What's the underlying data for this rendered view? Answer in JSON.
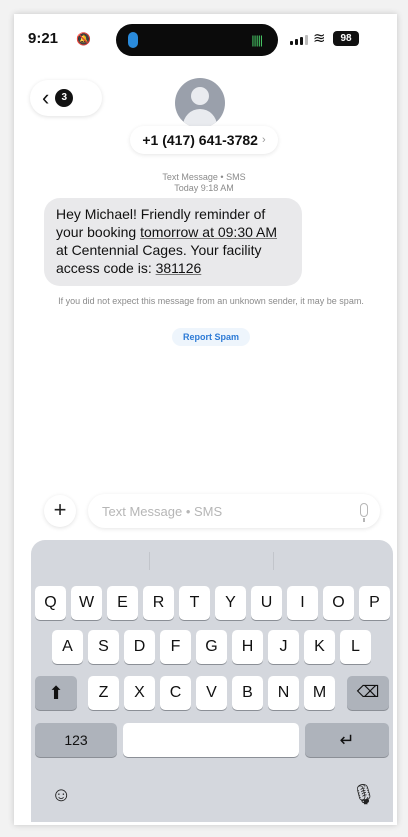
{
  "status": {
    "time": "9:21",
    "battery": "98"
  },
  "header": {
    "back_count": "3",
    "contact": "+1 (417) 641-3782"
  },
  "conversation": {
    "meta_line1": "Text Message • SMS",
    "meta_line2": "Today 9:18 AM",
    "message": {
      "part1": "Hey Michael! Friendly reminder of your booking ",
      "link_time": "tomorrow at 09:30 AM",
      "part2": " at Centennial Cages. Your facility access code is: ",
      "link_code": "381126"
    },
    "spam_note": "If you did not expect this message from an unknown sender, it may be spam.",
    "report_spam": "Report Spam"
  },
  "compose": {
    "placeholder": "Text Message • SMS"
  },
  "keyboard": {
    "row1": [
      "Q",
      "W",
      "E",
      "R",
      "T",
      "Y",
      "U",
      "I",
      "O",
      "P"
    ],
    "row2": [
      "A",
      "S",
      "D",
      "F",
      "G",
      "H",
      "J",
      "K",
      "L"
    ],
    "row3": [
      "Z",
      "X",
      "C",
      "V",
      "B",
      "N",
      "M"
    ],
    "numbers_key": "123"
  },
  "icons": {
    "back": "chevron-left-icon",
    "shift": "shift-icon",
    "backspace": "backspace-icon",
    "return": "return-icon",
    "emoji": "emoji-icon",
    "dictation": "microphone-icon"
  }
}
